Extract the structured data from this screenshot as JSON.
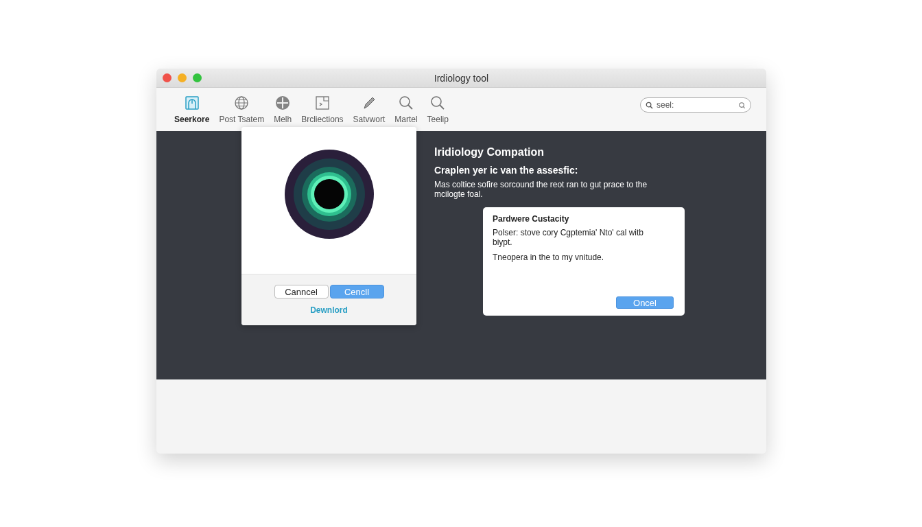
{
  "window": {
    "title": "Irdiology tool"
  },
  "toolbar": {
    "items": [
      {
        "label": "Seerkore",
        "selected": true
      },
      {
        "label": "Post Tsatem",
        "selected": false
      },
      {
        "label": "Melh",
        "selected": false
      },
      {
        "label": "Brcliections",
        "selected": false
      },
      {
        "label": "Satvwort",
        "selected": false
      },
      {
        "label": "Martel",
        "selected": false
      },
      {
        "label": "Teelip",
        "selected": false
      }
    ],
    "search": {
      "placeholder": "seel:"
    }
  },
  "image_dialog": {
    "buttons": [
      {
        "label": "Canncel",
        "primary": false
      },
      {
        "label": "Cencll",
        "primary": true
      }
    ],
    "link": "Dewnlord"
  },
  "info": {
    "title": "Iridiology Compation",
    "subtitle": "Craplen yer ic van the assesfic:",
    "body": "Mas coltice sofire sorcound the reot ran to gut prace to the mcilogte foal."
  },
  "alert": {
    "title": "Pardwere Custacity",
    "messages": [
      "Polser: stove cory Cgptemia' Nto' cal witb biypt.",
      "Tneopera in the to my vnitude."
    ],
    "button": "Oncel"
  }
}
